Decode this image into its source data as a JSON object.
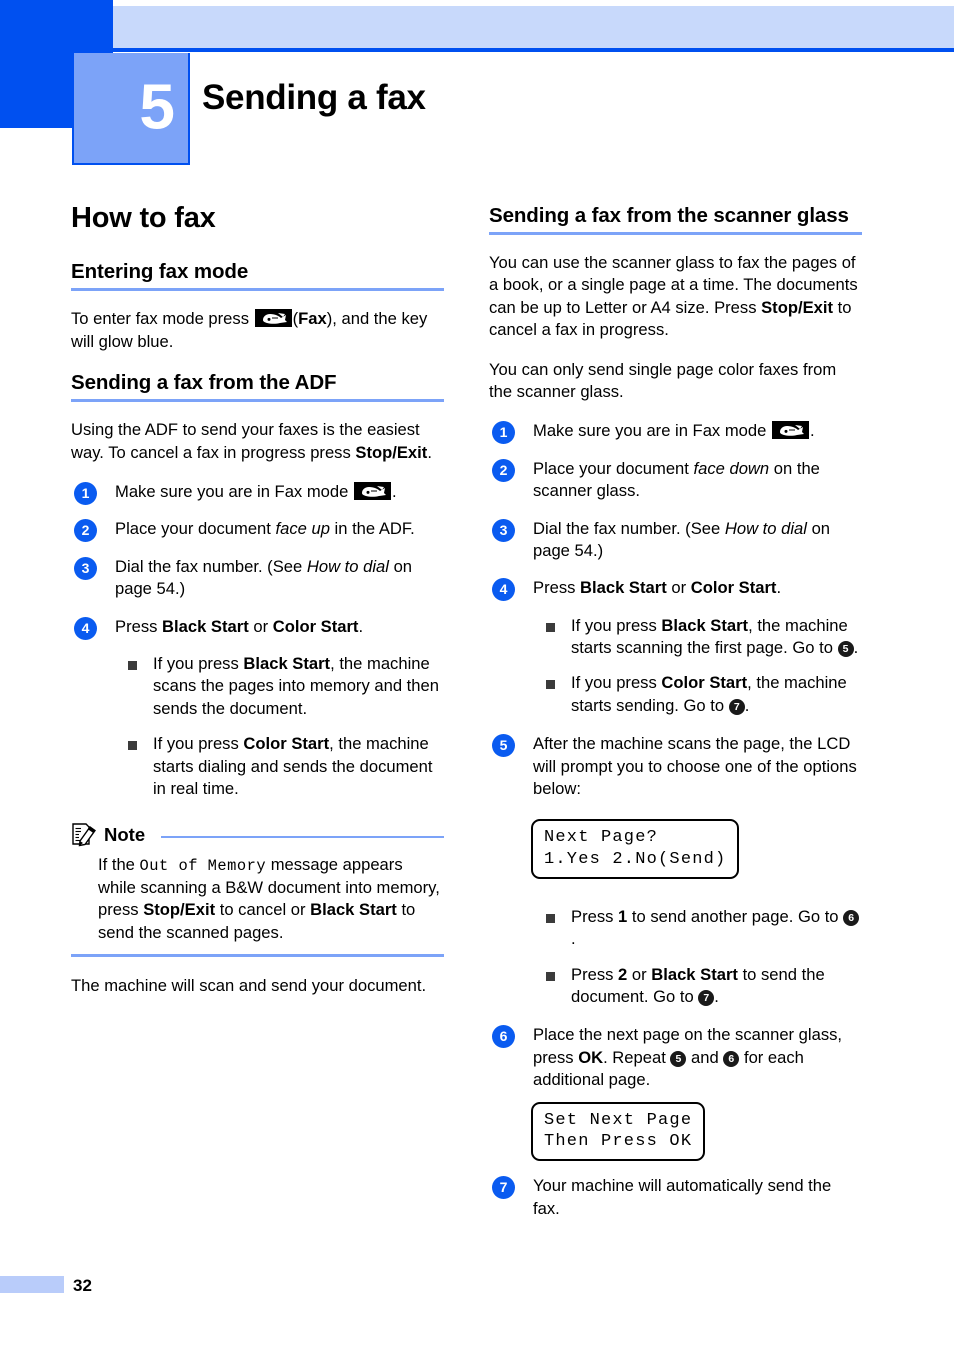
{
  "header": {
    "chapter_number": "5",
    "chapter_title": "Sending a fax"
  },
  "left_column": {
    "main_heading": "How to fax",
    "section1": {
      "heading": "Entering fax mode",
      "para_pre": "To enter fax mode press ",
      "para_bold": "Fax",
      "para_post": "), and the key will glow blue.",
      "para_paren_open": "("
    },
    "section2": {
      "heading": "Sending a fax from the ADF",
      "intro_pre": "Using the ADF to send your faxes is the easiest way. To cancel a fax in progress press ",
      "intro_bold": "Stop/Exit",
      "intro_post": ".",
      "steps": [
        {
          "num": "1",
          "text_pre": "Make sure you are in Fax mode ",
          "text_post": "."
        },
        {
          "num": "2",
          "text_pre": "Place your document ",
          "italic": "face up",
          "text_post": " in the ADF."
        },
        {
          "num": "3",
          "text_pre": "Dial the fax number. (See ",
          "italic": "How to dial",
          "text_post": " on page 54.)"
        },
        {
          "num": "4",
          "text_pre": "Press ",
          "bold1": "Black Start",
          "mid": " or ",
          "bold2": "Color Start",
          "text_post": "."
        }
      ],
      "bullets": [
        {
          "pre": "If you press ",
          "bold": "Black Start",
          "post": ", the machine scans the pages into memory and then sends the document."
        },
        {
          "pre": "If you press ",
          "bold": "Color Start",
          "post": ", the machine starts dialing and sends the document in real time."
        }
      ]
    },
    "note": {
      "title": "Note",
      "text_a": "If the ",
      "mono": "Out of Memory",
      "text_b": " message appears while scanning a B&W document into memory, press ",
      "bold_a": "Stop/Exit",
      "text_c": " to cancel or ",
      "bold_b": "Black Start",
      "text_d": " to send the scanned pages."
    },
    "closing_para": "The machine will scan and send your document."
  },
  "right_column": {
    "heading": "Sending a fax from the scanner glass",
    "para1_pre": "You can use the scanner glass to fax the pages of a book, or a single page at a time. The documents can be up to Letter or A4 size. Press ",
    "para1_bold": "Stop/Exit",
    "para1_post": " to cancel a fax in progress.",
    "para2": "You can only send single page color faxes from the scanner glass.",
    "steps": [
      {
        "num": "1",
        "text_pre": "Make sure you are in Fax mode ",
        "text_post": "."
      },
      {
        "num": "2",
        "text_pre": "Place your document ",
        "italic": "face down",
        "text_post": " on the scanner glass."
      },
      {
        "num": "3",
        "text_pre": "Dial the fax number. (See ",
        "italic": "How to dial",
        "text_post": " on page 54.)"
      },
      {
        "num": "4",
        "text_pre": "Press ",
        "bold1": "Black Start",
        "mid": "  or ",
        "bold2": "Color Start",
        "text_post": "."
      },
      {
        "num": "5",
        "text": "After the machine scans the page, the LCD will prompt you to choose one of the options below:"
      },
      {
        "num": "6",
        "text_pre": "Place the next page on the scanner glass, press ",
        "bold": "OK",
        "text_mid": ". Repeat ",
        "ref1": "5",
        "text_and": " and ",
        "ref2": "6",
        "text_post": " for each additional page."
      },
      {
        "num": "7",
        "text": "Your machine will automatically send the fax."
      }
    ],
    "step4_bullets": [
      {
        "pre": "If you press ",
        "bold": "Black Start",
        "post": ", the machine starts scanning the first page. Go to ",
        "ref": "5",
        "tail": "."
      },
      {
        "pre": "If you press ",
        "bold": "Color Start",
        "post": ", the machine starts sending. Go to ",
        "ref": "7",
        "tail": "."
      }
    ],
    "lcd1": {
      "line1": "Next Page?",
      "line2": "1.Yes 2.No(Send)"
    },
    "step5_bullets": [
      {
        "pre": "Press ",
        "bold": "1",
        "post": " to send another page. Go to ",
        "ref": "6",
        "tail": "."
      },
      {
        "pre": "Press ",
        "bold": "2",
        "mid": " or ",
        "bold2": "Black Start",
        "post": " to send the document. Go to ",
        "ref": "7",
        "tail": "."
      }
    ],
    "lcd2": {
      "line1": "Set Next Page",
      "line2": "Then Press OK"
    }
  },
  "footer": {
    "page_number": "32"
  },
  "colors": {
    "header_blue": "#0050f0",
    "header_light": "#c8d9fb",
    "chapter_box": "#7ca3f8",
    "rule_blue": "#7ca3f8",
    "step_circle": "#0a5bf0",
    "footer_swatch": "#b9ccfa"
  }
}
